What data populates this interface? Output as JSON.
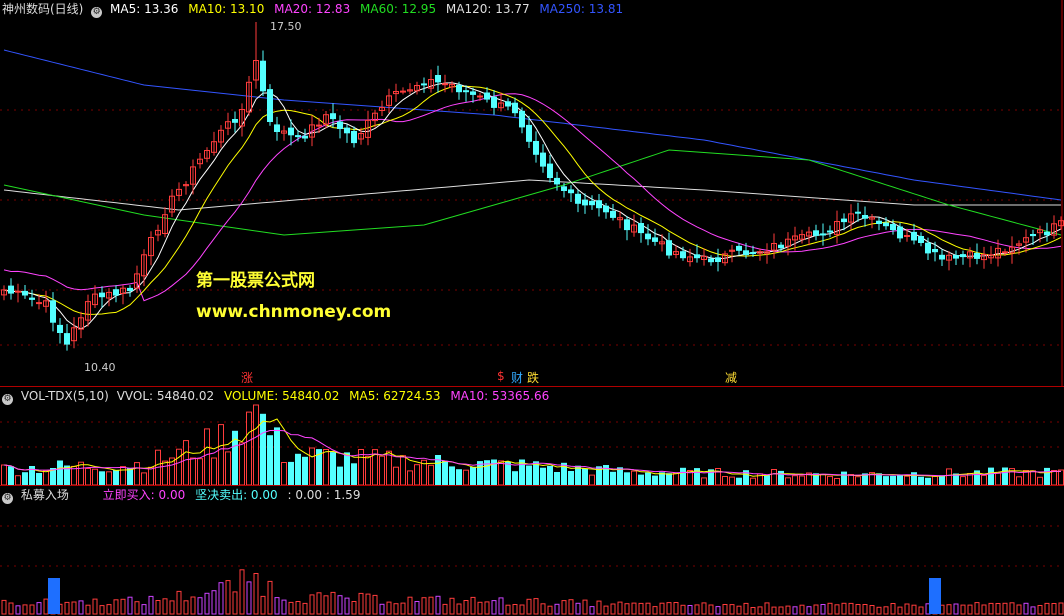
{
  "price": {
    "title": "神州数码(日线)",
    "ma": [
      {
        "label": "MA5: 13.36",
        "color": "#ffffff"
      },
      {
        "label": "MA10: 13.10",
        "color": "#ffff00"
      },
      {
        "label": "MA20: 12.83",
        "color": "#ff44ff"
      },
      {
        "label": "MA60: 12.95",
        "color": "#22dd22"
      },
      {
        "label": "MA120: 13.77",
        "color": "#dddddd"
      },
      {
        "label": "MA250: 13.81",
        "color": "#3355ff"
      }
    ],
    "high_label": "17.50",
    "low_label": "10.40",
    "markers": [
      {
        "text": "涨",
        "color": "#ff3333"
      },
      {
        "text": "$",
        "color": "#ff3333"
      },
      {
        "text": "财",
        "color": "#33aaff"
      },
      {
        "text": "跌",
        "color": "#ffdd33"
      },
      {
        "text": "减",
        "color": "#ffdd33"
      }
    ],
    "watermark_cn": "第一股票公式网",
    "watermark_url": "www.chnmoney.com"
  },
  "volume": {
    "title": "VOL-TDX(5,10)",
    "vvol": "VVOL: 54840.02",
    "volume": "VOLUME: 54840.02",
    "ma5": "MA5: 62724.53",
    "ma10": "MA10: 53365.66"
  },
  "indicator": {
    "title": "私募入场",
    "buy": "立即买入: 0.00",
    "sell": "坚决卖出: 0.00",
    "extra": ": 0.00 : 1.59"
  },
  "colors": {
    "up": "#ff3c3c",
    "down": "#54ffff",
    "grid": "#7a0000",
    "ma5": "#ffffff",
    "ma10": "#ffff00",
    "ma20": "#ff44ff",
    "ma60": "#22dd22",
    "ma120": "#dddddd",
    "ma250": "#3355ff"
  }
}
